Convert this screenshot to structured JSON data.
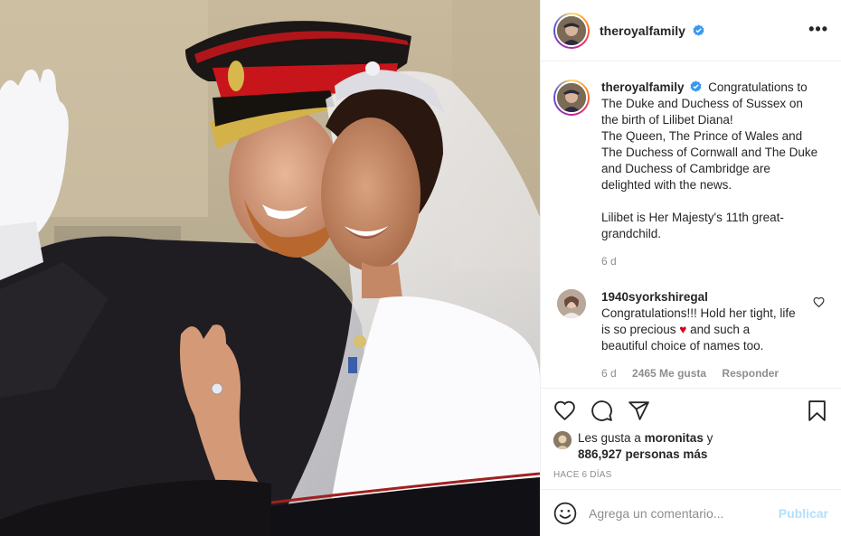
{
  "header": {
    "username": "theroyalfamily",
    "more_label": "•••"
  },
  "caption": {
    "username": "theroyalfamily",
    "line1": "Congratulations to The Duke and Duchess of Sussex on the birth of Lilibet Diana!",
    "line2": "The Queen, The Prince of Wales and The Duchess of Cornwall and The Duke and Duchess of Cambridge are delighted with the news.",
    "line3": "Lilibet is Her Majesty's 11th great-grandchild.",
    "time": "6 d"
  },
  "comment": {
    "username": "1940syorkshiregal",
    "text_before": "Congratulations!!! Hold her tight, life is so precious ",
    "text_after": " and such a beautiful choice of names too.",
    "time": "6 d",
    "likes": "2465 Me gusta",
    "reply": "Responder"
  },
  "likes": {
    "prefix": "Les gusta a ",
    "user": "moronitas",
    "connector": " y",
    "others": "886,927 personas más"
  },
  "posted_ago": "HACE 6 DÍAS",
  "add_comment": {
    "placeholder": "Agrega un comentario...",
    "publish": "Publicar"
  },
  "colors": {
    "verified": "#3897f0",
    "heart": "#ed4956",
    "publish_disabled": "#b2dffc"
  },
  "icons": [
    "heart-icon",
    "comment-icon",
    "share-icon",
    "bookmark-icon",
    "emoji-icon",
    "verified-icon",
    "more-icon"
  ]
}
